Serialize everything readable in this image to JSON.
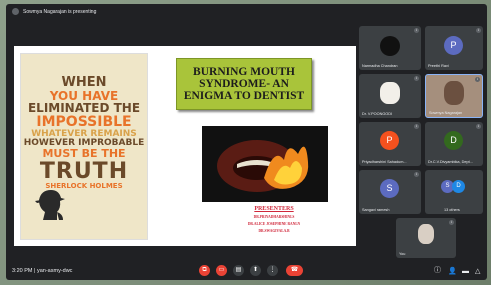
{
  "meeting": {
    "presenting_text": "Sowmya Nagarajan is presenting",
    "time": "3:20 PM",
    "meeting_code": "yan-asmy-dwc"
  },
  "poster": {
    "lines": [
      "WHEN",
      "YOU HAVE",
      "ELIMINATED THE",
      "IMPOSSIBLE",
      "WHATEVER REMAINS",
      "HOWEVER IMPROBABLE",
      "MUST BE THE",
      "TRUTH",
      "SHERLOCK HOLMES"
    ]
  },
  "slide": {
    "title": "BURNING MOUTH SYNDROME- AN ENIGMA TO DENTIST",
    "presenters_heading": "PRESENTERS",
    "presenters": [
      "DR.PRIYADHARSHINI.S",
      "DR.ALICE JOSEPHINE RANI.N",
      "DR.SWAGIVALA.B"
    ]
  },
  "participants": [
    {
      "name": "Narmadha Chandran",
      "initial": "",
      "color": "#1a1a1a"
    },
    {
      "name": "Preethi Ravi",
      "initial": "P",
      "color": "#5c6bc0"
    },
    {
      "name": "Dr. V.POONGODI",
      "initial": "",
      "color": "#f2efe9"
    },
    {
      "name": "Sowmya Nagarajan",
      "initial": "",
      "color": "#a58f7d"
    },
    {
      "name": "Priyadharshini Sahadum...",
      "initial": "P",
      "color": "#f4511e"
    },
    {
      "name": "Dr.C.V.Divyambika, Dept...",
      "initial": "D",
      "color": "#33691e"
    },
    {
      "name": "Sangavi ramesh",
      "initial": "S",
      "color": "#5c6bc0"
    },
    {
      "name": "13 others",
      "initial": "",
      "color": ""
    },
    {
      "name": "You",
      "initial": "",
      "color": "#d9cfc4"
    }
  ],
  "others_avatars": [
    "S",
    "D"
  ],
  "controls": {
    "end_call_color": "#ea4335"
  }
}
